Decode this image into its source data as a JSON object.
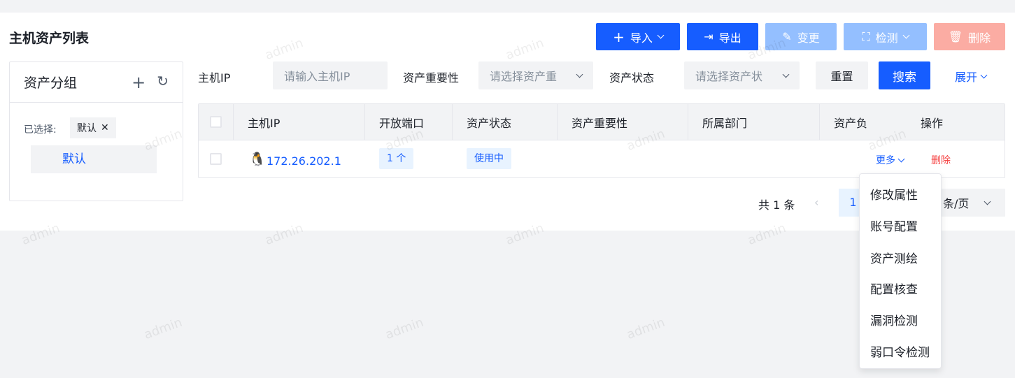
{
  "page": {
    "title": "主机资产列表"
  },
  "toolbar": {
    "import": "导入",
    "export": "导出",
    "change": "变更",
    "detect": "检测",
    "delete": "删除"
  },
  "colors": {
    "primary": "#165dff",
    "primary_disabled": "#94bfff",
    "danger_disabled": "#fbaca3",
    "danger": "#f53f3f"
  },
  "sidebar": {
    "title": "资产分组",
    "selected_label": "已选择:",
    "selected_tag": "默认",
    "items": [
      {
        "label": "默认"
      }
    ]
  },
  "filters": {
    "host_ip_label": "主机IP",
    "host_ip_placeholder": "请输入主机IP",
    "importance_label": "资产重要性",
    "importance_placeholder": "请选择资产重",
    "status_label": "资产状态",
    "status_placeholder": "请选择资产状",
    "reset": "重置",
    "search": "搜索",
    "expand": "展开"
  },
  "table": {
    "columns": [
      "主机IP",
      "开放端口",
      "资产状态",
      "资产重要性",
      "所属部门",
      "资产负",
      "操作"
    ],
    "rows": [
      {
        "ip": "172.26.202.1",
        "ports": "1 个",
        "status": "使用中",
        "more": "更多",
        "delete": "删除"
      }
    ]
  },
  "pagination": {
    "total": "共 1 条",
    "current_page": "1",
    "page_size": "条/页"
  },
  "more_menu": [
    "修改属性",
    "账号配置",
    "资产测绘",
    "配置核查",
    "漏洞检测",
    "弱口令检测"
  ],
  "watermark": "admin"
}
